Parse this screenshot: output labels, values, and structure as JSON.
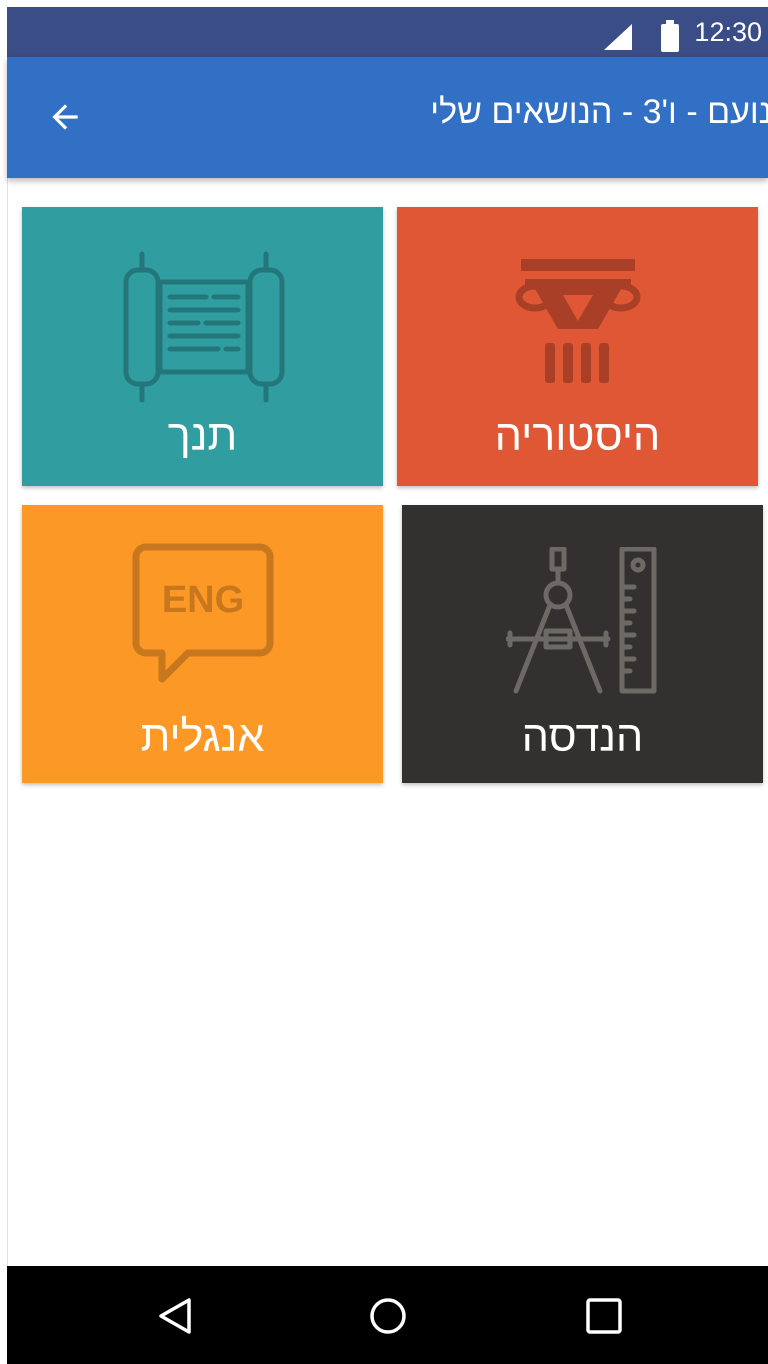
{
  "status_bar": {
    "time": "12:30",
    "icons": [
      "signal-icon",
      "battery-icon"
    ]
  },
  "app_bar": {
    "title": "נועם  - ו'3 - הנושאים שלי",
    "back_icon": "arrow-back-icon"
  },
  "subjects": [
    {
      "label": "תנך",
      "icon": "torah-scroll-icon",
      "color": "#309ea1"
    },
    {
      "label": "היסטוריה",
      "icon": "column-icon",
      "color": "#df5735"
    },
    {
      "label": "אנגלית",
      "icon": "eng-speech-bubble-icon",
      "icon_text": "ENG",
      "color": "#fc9826"
    },
    {
      "label": "הנדסה",
      "icon": "compass-ruler-icon",
      "color": "#323130"
    }
  ],
  "nav_bar": {
    "buttons": [
      "back-triangle-icon",
      "home-circle-icon",
      "recents-square-icon"
    ]
  },
  "colors": {
    "status_bar": "#3b4d87",
    "app_bar": "#3270c6",
    "nav_bar": "#000000"
  }
}
